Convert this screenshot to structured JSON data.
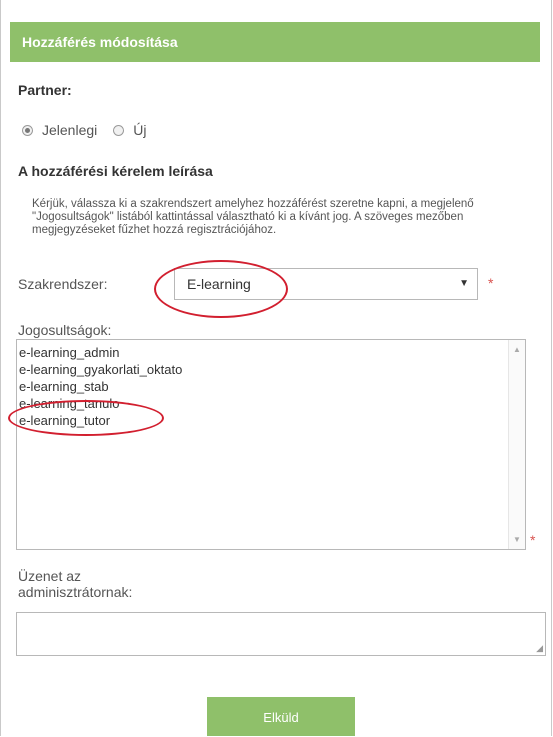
{
  "header": {
    "title": "Hozzáférés módosítása"
  },
  "partner": {
    "label": "Partner:",
    "options": [
      {
        "label": "Jelenlegi",
        "checked": true
      },
      {
        "label": "Új",
        "checked": false
      }
    ]
  },
  "request": {
    "title": "A hozzáférési kérelem leírása",
    "description": "Kérjük, válassza ki a szakrendszert amelyhez hozzáférést szeretne kapni, a megjelenő \"Jogosultságok\" listából kattintással választható ki a kívánt jog. A szöveges mezőben megjegyzéseket fűzhet hozzá regisztrációjához."
  },
  "system": {
    "label": "Szakrendszer:",
    "selected": "E-learning",
    "required_mark": "*"
  },
  "rights": {
    "label": "Jogosultságok:",
    "items": [
      "e-learning_admin",
      "e-learning_gyakorlati_oktato",
      "e-learning_stab",
      "e-learning_tanulo",
      "e-learning_tutor"
    ],
    "required_mark": "*"
  },
  "message": {
    "label": "Üzenet az adminisztrátornak:",
    "value": ""
  },
  "submit": {
    "label": "Elküld"
  },
  "colors": {
    "accent": "#8fc06a",
    "annotation": "#d21f2f",
    "required": "#d9534f"
  }
}
